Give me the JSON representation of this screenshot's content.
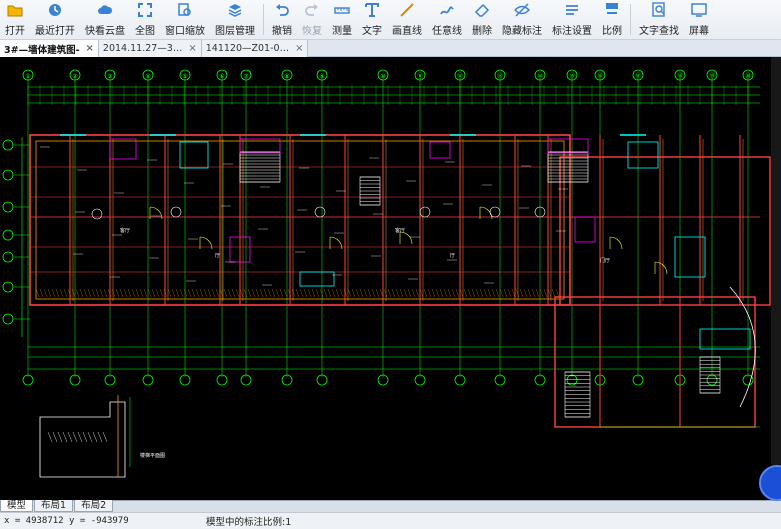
{
  "toolbar": {
    "buttons": [
      {
        "label": "打开",
        "icon": "folder-icon"
      },
      {
        "label": "最近打开",
        "icon": "clock-icon"
      },
      {
        "label": "快看云盘",
        "icon": "cloud-icon"
      },
      {
        "label": "全图",
        "icon": "fit-all-icon"
      },
      {
        "label": "窗口缩放",
        "icon": "zoom-window-icon"
      },
      {
        "label": "图层管理",
        "icon": "layers-icon"
      },
      {
        "label": "撤销",
        "icon": "undo-icon"
      },
      {
        "label": "恢复",
        "icon": "redo-icon"
      },
      {
        "label": "测量",
        "icon": "measure-icon"
      },
      {
        "label": "文字",
        "icon": "text-icon"
      },
      {
        "label": "画直线",
        "icon": "line-icon"
      },
      {
        "label": "任意线",
        "icon": "freehand-icon"
      },
      {
        "label": "删除",
        "icon": "eraser-icon"
      },
      {
        "label": "隐藏标注",
        "icon": "hide-annotation-icon"
      },
      {
        "label": "标注设置",
        "icon": "annotation-settings-icon"
      },
      {
        "label": "比例",
        "icon": "scale-icon"
      },
      {
        "label": "文字查找",
        "icon": "text-search-icon"
      },
      {
        "label": "屏幕",
        "icon": "screen-icon"
      }
    ]
  },
  "tabs": [
    {
      "label": "3#—墙体建筑图-",
      "active": true
    },
    {
      "label": "2014.11.27—3…",
      "active": false
    },
    {
      "label": "141120—Z01-0…",
      "active": false
    }
  ],
  "layout_tabs": [
    "模型",
    "布局1",
    "布局2"
  ],
  "status": {
    "coords": "x = 4938712 y = -943979",
    "scale_text": "模型中的标注比例:1"
  },
  "drawing": {
    "grid_labels": [
      "①",
      "②",
      "③",
      "④",
      "⑤",
      "⑥",
      "⑦",
      "⑧",
      "⑨",
      "⑩",
      "⑪",
      "⑫",
      "⑬",
      "⑭",
      "⑮",
      "⑯",
      "⑰",
      "⑱",
      "⑲",
      "⑳"
    ],
    "room_labels": [
      "厅",
      "厅",
      "客厅",
      "客厅",
      "门厅"
    ],
    "section_caption": "楼梯平面图"
  },
  "colors": {
    "canvas_bg": "#000000",
    "wall": "#ff4040",
    "axis": "#00ff00",
    "door": "#ffff00",
    "stair": "#ffffff",
    "cyan": "#00ffff",
    "magenta": "#ff00ff",
    "orange": "#ff9900",
    "accent": "#1a4fd6"
  }
}
